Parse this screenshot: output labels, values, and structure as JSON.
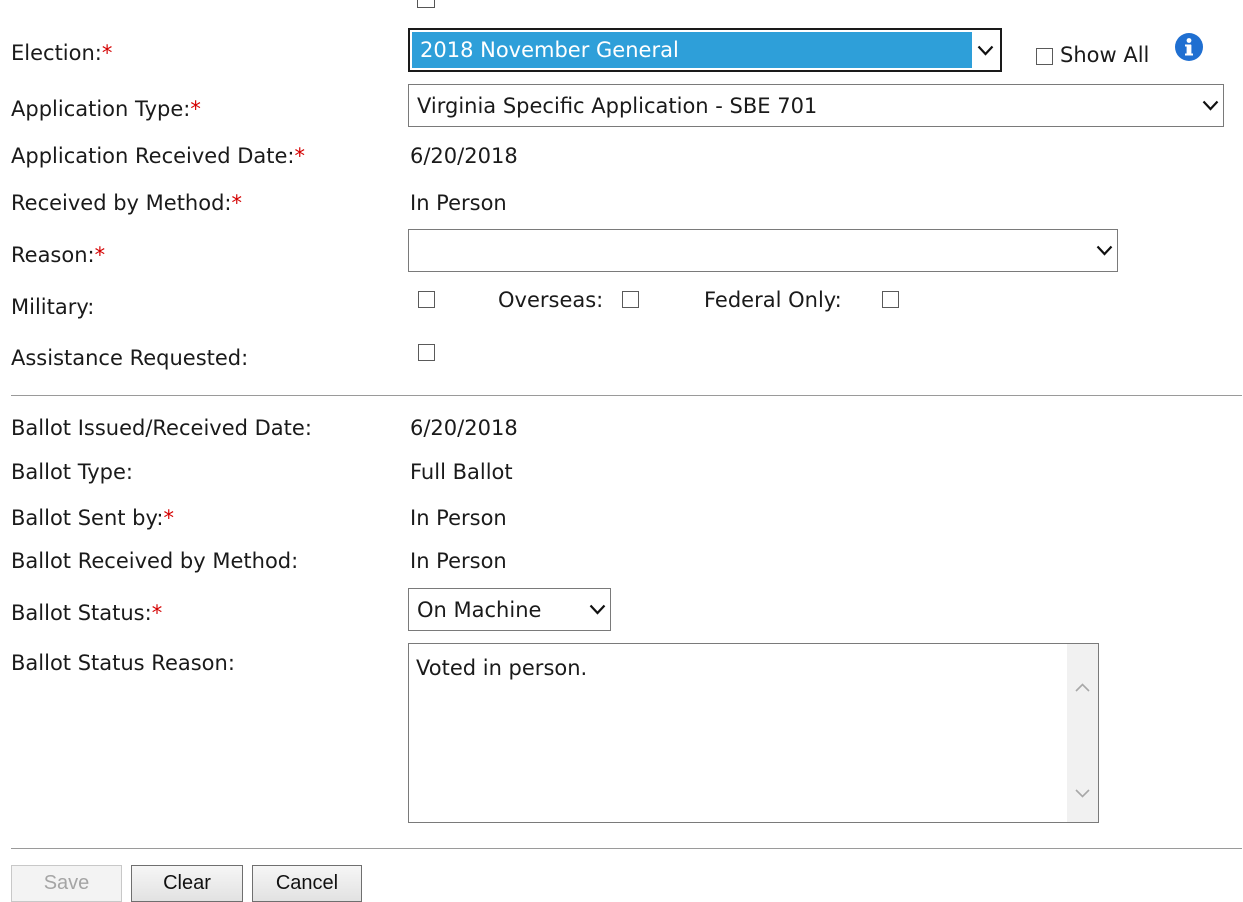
{
  "form": {
    "election": {
      "label": "Election:",
      "required": "*",
      "value": "2018 November General",
      "show_all_label": "Show All"
    },
    "application_type": {
      "label": "Application Type:",
      "required": "*",
      "value": "Virginia Specific Application - SBE 701"
    },
    "application_received_date": {
      "label": "Application Received Date:",
      "required": "*",
      "value": "6/20/2018"
    },
    "received_by_method": {
      "label": "Received by Method:",
      "required": "*",
      "value": "In Person"
    },
    "reason": {
      "label": "Reason:",
      "required": "*",
      "value": ""
    },
    "military": {
      "label": "Military:",
      "checked": false,
      "overseas_label": "Overseas:",
      "overseas_checked": false,
      "federal_only_label": "Federal Only:",
      "federal_only_checked": false
    },
    "assistance_requested": {
      "label": "Assistance Requested:",
      "checked": false
    }
  },
  "ballot": {
    "issued_received_date": {
      "label": "Ballot Issued/Received Date:",
      "value": "6/20/2018"
    },
    "type": {
      "label": "Ballot Type:",
      "value": "Full Ballot"
    },
    "sent_by": {
      "label": "Ballot Sent by:",
      "required": "*",
      "value": "In Person"
    },
    "received_by_method": {
      "label": "Ballot Received by Method:",
      "value": "In Person"
    },
    "status": {
      "label": "Ballot Status:",
      "required": "*",
      "value": "On Machine"
    },
    "status_reason": {
      "label": "Ballot Status Reason:",
      "value": "Voted in person."
    }
  },
  "buttons": {
    "save": "Save",
    "clear": "Clear",
    "cancel": "Cancel"
  },
  "colors": {
    "required": "#d40000",
    "selected_bg": "#2e9fd9",
    "info_icon": "#1f6fd1"
  },
  "icons": {
    "info": "info-icon",
    "dropdown": "chevron-down-icon"
  }
}
